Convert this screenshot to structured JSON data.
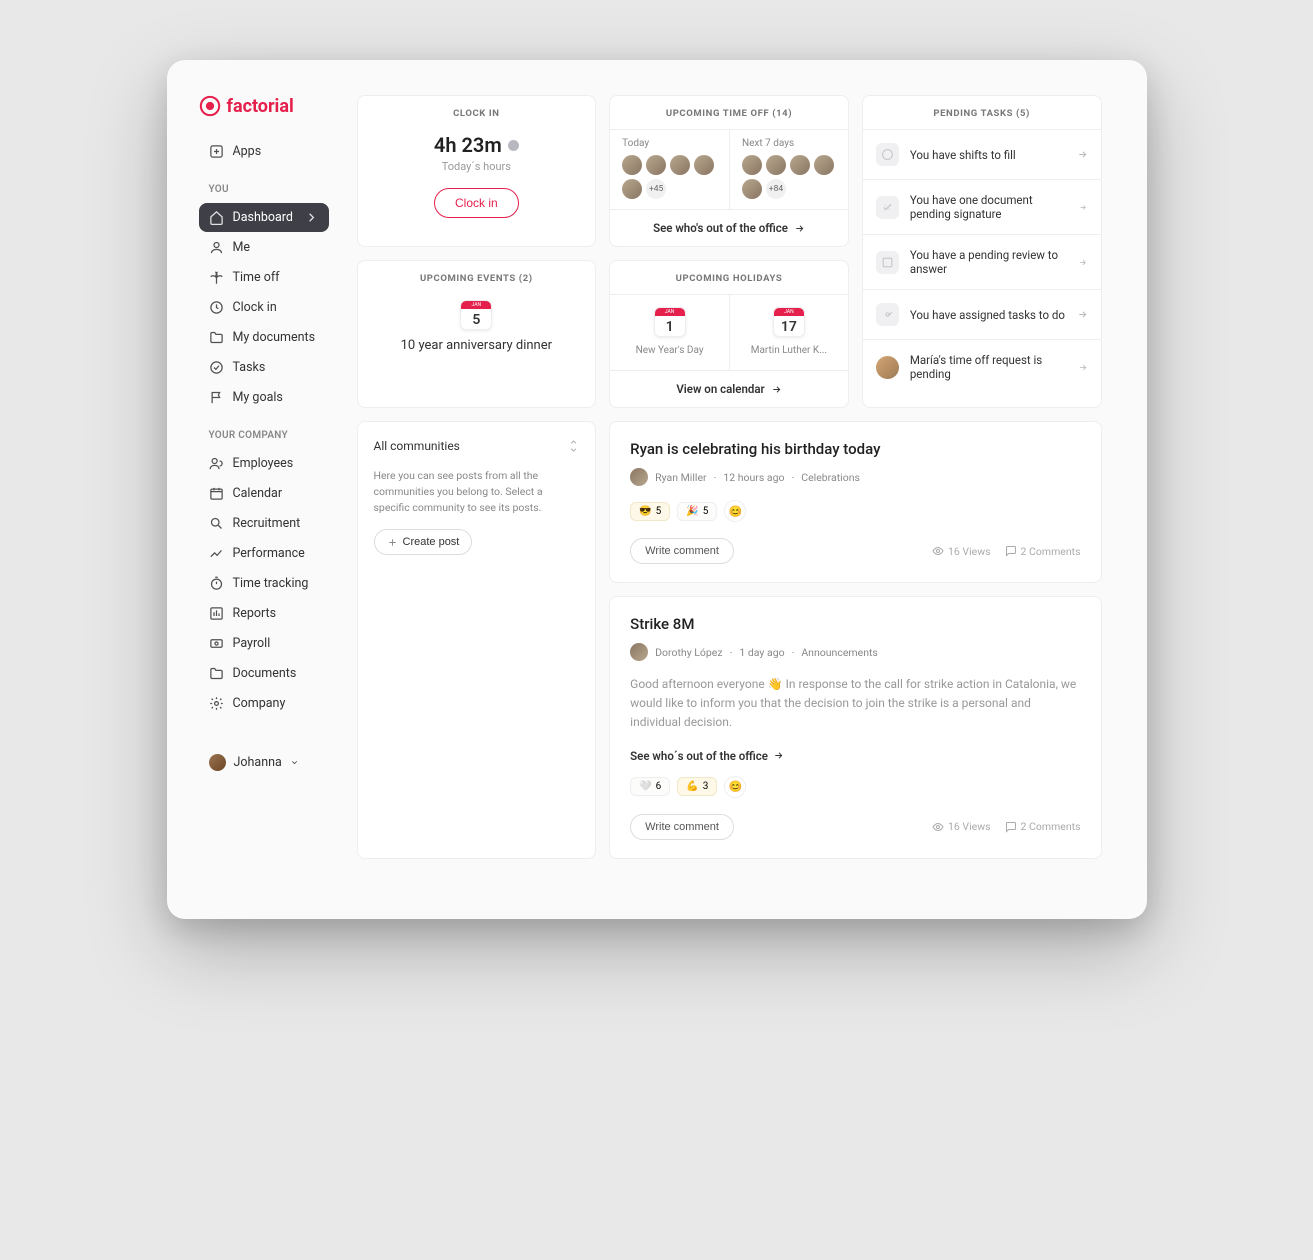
{
  "brand": "factorial",
  "nav": {
    "apps": "Apps",
    "you_label": "YOU",
    "dashboard": "Dashboard",
    "me": "Me",
    "time_off": "Time off",
    "clock_in": "Clock in",
    "my_documents": "My documents",
    "tasks": "Tasks",
    "my_goals": "My goals",
    "company_label": "YOUR COMPANY",
    "employees": "Employees",
    "calendar": "Calendar",
    "recruitment": "Recruitment",
    "performance": "Performance",
    "time_tracking": "Time tracking",
    "reports": "Reports",
    "payroll": "Payroll",
    "documents": "Documents",
    "company": "Company"
  },
  "user": {
    "name": "Johanna"
  },
  "clockin": {
    "header": "CLOCK IN",
    "time": "4h 23m",
    "sub": "Today´s hours",
    "button": "Clock in"
  },
  "timeoff": {
    "header": "UPCOMING TIME OFF (14)",
    "today_label": "Today",
    "next7_label": "Next 7 days",
    "more_today": "+45",
    "more_next": "+84",
    "footer": "See who's out of the office"
  },
  "tasks": {
    "header": "PENDING TASKS (5)",
    "items": [
      "You have shifts to fill",
      "You have one document pending signature",
      "You have a pending review to answer",
      "You have assigned tasks to do",
      "María's time off request is pending"
    ]
  },
  "events": {
    "header": "UPCOMING EVENTS (2)",
    "month": "JAN",
    "day": "5",
    "title": "10 year anniversary dinner"
  },
  "holidays": {
    "header": "UPCOMING HOLIDAYS",
    "items": [
      {
        "month": "JAN",
        "day": "1",
        "name": "New Year's Day"
      },
      {
        "month": "JAN",
        "day": "17",
        "name": "Martin Luther K..."
      }
    ],
    "footer": "View on calendar"
  },
  "community": {
    "select": "All communities",
    "desc": "Here you can see posts from all the communities you belong to. Select a specific community to see its posts.",
    "create": "Create post"
  },
  "posts": [
    {
      "title": "Ryan is celebrating his birthday today",
      "author": "Ryan Miller",
      "time": "12 hours ago",
      "channel": "Celebrations",
      "body": "",
      "link": "",
      "reactions": [
        {
          "emoji": "😎",
          "count": "5",
          "style": "party"
        },
        {
          "emoji": "🎉",
          "count": "5",
          "style": ""
        }
      ],
      "write": "Write comment",
      "views": "16 Views",
      "comments": "2 Comments"
    },
    {
      "title": "Strike 8M",
      "author": "Dorothy López",
      "time": "1 day ago",
      "channel": "Announcements",
      "body": "Good afternoon everyone 👋\nIn response to the call for strike action in Catalonia, we would like to inform you that the decision to join the strike is a personal and individual decision.",
      "link": "See who´s out of the office",
      "reactions": [
        {
          "emoji": "🤍",
          "count": "6",
          "style": ""
        },
        {
          "emoji": "💪",
          "count": "3",
          "style": "party"
        }
      ],
      "write": "Write comment",
      "views": "16 Views",
      "comments": "2 Comments"
    }
  ]
}
